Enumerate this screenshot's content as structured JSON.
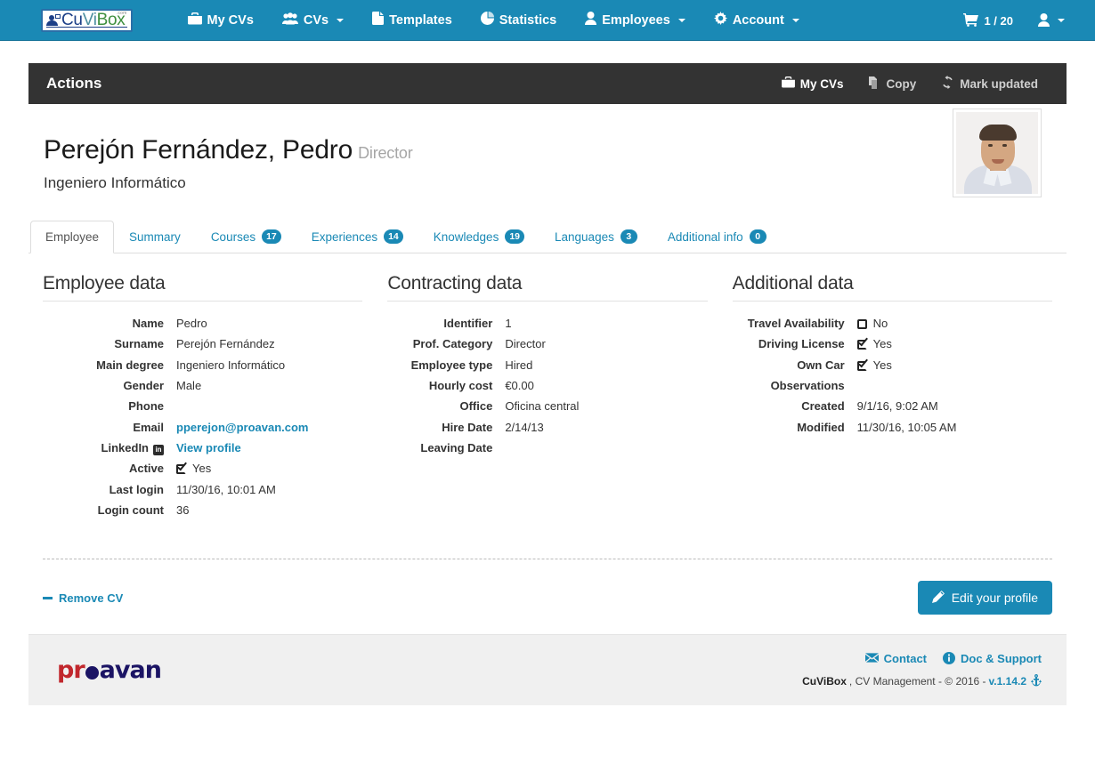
{
  "navbar": {
    "brand": {
      "cu": "Cu",
      "vi": "Vi",
      "box": "Box",
      "tld": ".com",
      "icon": "user-screen-icon"
    },
    "items": [
      {
        "label": "My CVs",
        "icon": "briefcase-icon",
        "caret": false
      },
      {
        "label": "CVs",
        "icon": "users-group-icon",
        "caret": true
      },
      {
        "label": "Templates",
        "icon": "file-text-icon",
        "caret": false
      },
      {
        "label": "Statistics",
        "icon": "pie-chart-icon",
        "caret": false
      },
      {
        "label": "Employees",
        "icon": "user-icon",
        "caret": true
      },
      {
        "label": "Account",
        "icon": "gear-icon",
        "caret": true
      }
    ],
    "cart": {
      "icon": "shopping-cart-icon",
      "label": "1 / 20"
    },
    "user_menu": {
      "icon": "user-icon",
      "caret": true
    }
  },
  "actions_bar": {
    "title": "Actions",
    "links": [
      {
        "label": "My CVs",
        "icon": "briefcase-icon"
      },
      {
        "label": "Copy",
        "icon": "copy-icon"
      },
      {
        "label": "Mark updated",
        "icon": "refresh-icon"
      }
    ]
  },
  "profile": {
    "full_name": "Perejón Fernández, Pedro",
    "role": "Director",
    "degree": "Ingeniero Informático",
    "avatar_alt": "employee-photo"
  },
  "tabs": [
    {
      "label": "Employee",
      "badge": null,
      "active": true
    },
    {
      "label": "Summary",
      "badge": null,
      "active": false
    },
    {
      "label": "Courses",
      "badge": "17",
      "active": false
    },
    {
      "label": "Experiences",
      "badge": "14",
      "active": false
    },
    {
      "label": "Knowledges",
      "badge": "19",
      "active": false
    },
    {
      "label": "Languages",
      "badge": "3",
      "active": false
    },
    {
      "label": "Additional info",
      "badge": "0",
      "active": false
    }
  ],
  "employee_data": {
    "title": "Employee data",
    "rows": [
      {
        "label": "Name",
        "value": "Pedro",
        "type": "text"
      },
      {
        "label": "Surname",
        "value": "Perejón Fernández",
        "type": "text"
      },
      {
        "label": "Main degree",
        "value": "Ingeniero Informático",
        "type": "text"
      },
      {
        "label": "Gender",
        "value": "Male",
        "type": "text"
      },
      {
        "label": "Phone",
        "value": "",
        "type": "text"
      },
      {
        "label": "Email",
        "value": "pperejon@proavan.com",
        "type": "link"
      },
      {
        "label": "LinkedIn",
        "value": "View profile",
        "type": "link",
        "label_icon": "linkedin-icon"
      },
      {
        "label": "Active",
        "value": "Yes",
        "type": "checkbox",
        "checked": true
      },
      {
        "label": "Last login",
        "value": "11/30/16, 10:01 AM",
        "type": "text"
      },
      {
        "label": "Login count",
        "value": "36",
        "type": "text"
      }
    ]
  },
  "contracting_data": {
    "title": "Contracting data",
    "rows": [
      {
        "label": "Identifier",
        "value": "1",
        "type": "text"
      },
      {
        "label": "Prof. Category",
        "value": "Director",
        "type": "text"
      },
      {
        "label": "Employee type",
        "value": "Hired",
        "type": "text"
      },
      {
        "label": "Hourly cost",
        "value": "€0.00",
        "type": "text"
      },
      {
        "label": "Office",
        "value": "Oficina central",
        "type": "text"
      },
      {
        "label": "Hire Date",
        "value": "2/14/13",
        "type": "text"
      },
      {
        "label": "Leaving Date",
        "value": "",
        "type": "text"
      }
    ]
  },
  "additional_data": {
    "title": "Additional data",
    "rows": [
      {
        "label": "Travel Availability",
        "value": "No",
        "type": "checkbox",
        "checked": false
      },
      {
        "label": "Driving License",
        "value": "Yes",
        "type": "checkbox",
        "checked": true
      },
      {
        "label": "Own Car",
        "value": "Yes",
        "type": "checkbox",
        "checked": true
      },
      {
        "label": "Observations",
        "value": "",
        "type": "text"
      },
      {
        "label": "Created",
        "value": "9/1/16, 9:02 AM",
        "type": "text"
      },
      {
        "label": "Modified",
        "value": "11/30/16, 10:05 AM",
        "type": "text"
      }
    ]
  },
  "bottom": {
    "remove_cv": "Remove CV",
    "edit_profile": "Edit your profile",
    "edit_icon": "pencil-icon",
    "remove_icon": "minus-icon"
  },
  "footer": {
    "company": {
      "pr": "pr",
      "avan": "avan"
    },
    "links": [
      {
        "label": "Contact",
        "icon": "envelope-icon"
      },
      {
        "label": "Doc & Support",
        "icon": "info-circle-icon"
      }
    ],
    "copyright_app": "CuViBox",
    "copyright_text": ", CV Management - © 2016 - ",
    "version": "v.1.14.2",
    "version_icon": "anchor-icon"
  },
  "colors": {
    "brand_blue": "#1a89b5",
    "dark_bar": "#333333",
    "link": "#1a89b5",
    "footer_bg": "#f0f0f0"
  }
}
